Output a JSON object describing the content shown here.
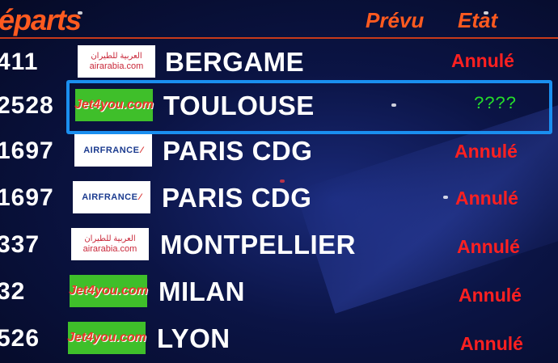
{
  "header": {
    "title": "éparts",
    "col_prevu": "Prévu",
    "col_etat": "Etat"
  },
  "rows": [
    {
      "flight": "411",
      "airline": "airarabia",
      "logo_text": "airarabia.com",
      "logo_arabic": "العربية للطيران",
      "city": "BERGAME",
      "status": "Annulé"
    },
    {
      "flight": "2528",
      "airline": "jet4you",
      "logo_text": "Jet4you.com",
      "city": "TOULOUSE",
      "status": "????"
    },
    {
      "flight": "1697",
      "airline": "airfrance",
      "logo_text": "AIRFRANCE",
      "city": "PARIS CDG",
      "status": "Annulé"
    },
    {
      "flight": "1697",
      "airline": "airfrance",
      "logo_text": "AIRFRANCE",
      "city": "PARIS CDG",
      "status": "Annulé"
    },
    {
      "flight": "337",
      "airline": "airarabia",
      "logo_text": "airarabia.com",
      "logo_arabic": "العربية للطيران",
      "city": "MONTPELLIER",
      "status": "Annulé"
    },
    {
      "flight": "32",
      "airline": "jet4you",
      "logo_text": "Jet4you.com",
      "city": "MILAN",
      "status": "Annulé"
    },
    {
      "flight": "526",
      "airline": "jet4you",
      "logo_text": "Jet4you.com",
      "city": "LYON",
      "status": "Annulé"
    }
  ],
  "colors": {
    "header_text": "#ff5a1f",
    "status_cancelled": "#ff2020",
    "status_unknown": "#25e02a",
    "highlight_border": "#1a8ff0",
    "board_background": "#0b1445"
  }
}
